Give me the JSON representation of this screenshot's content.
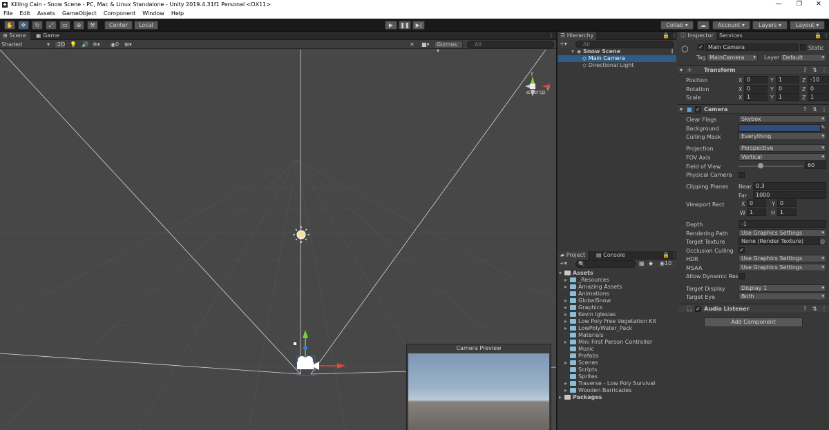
{
  "window": {
    "title": "Killing Cain - Snow Scene - PC, Mac & Linux Standalone - Unity 2019.4.31f1 Personal <DX11>",
    "minimize": "—",
    "maximize": "❐",
    "close": "✕"
  },
  "menu": [
    "File",
    "Edit",
    "Assets",
    "GameObject",
    "Component",
    "Window",
    "Help"
  ],
  "toolbar": {
    "pivot": "Center",
    "space": "Local",
    "collab": "Collab ▾",
    "account": "Account ▾",
    "layers": "Layers ▾",
    "layout": "Layout ▾"
  },
  "scene": {
    "tab_scene": "Scene",
    "tab_game": "Game",
    "draw_mode": "Shaded",
    "mode_2d": "2D",
    "hidden_count": "0",
    "gizmos": "Gizmos",
    "search_placeholder": "All",
    "persp": "Persp",
    "axis_y": "y",
    "axis_x": "x"
  },
  "preview": {
    "title": "Camera Preview"
  },
  "hierarchy": {
    "title": "Hierarchy",
    "search_placeholder": "All",
    "scene": "Snow Scene",
    "items": [
      "Main Camera",
      "Directional Light"
    ]
  },
  "project": {
    "tab_project": "Project",
    "tab_console": "Console",
    "count": "10",
    "root": "Assets",
    "folders": [
      "_Resources",
      "Amazing Assets",
      "Animations",
      "GlobalSnow",
      "Graphics",
      "Kevin Iglesias",
      "Low Poly Free Vegetation Kit",
      "LowPolyWater_Pack",
      "Materials",
      "Mini First Person Controller",
      "Music",
      "Prefabs",
      "Scenes",
      "Scripts",
      "Sprites",
      "Traverse - Low Poly Survival",
      "Wooden Barricades"
    ],
    "packages": "Packages"
  },
  "inspector": {
    "tab_inspector": "Inspector",
    "tab_services": "Services",
    "object_name": "Main Camera",
    "static": "Static",
    "tag_label": "Tag",
    "tag": "MainCamera",
    "layer_label": "Layer",
    "layer": "Default",
    "transform": {
      "title": "Transform",
      "position": "Position",
      "rotation": "Rotation",
      "scale": "Scale",
      "pos": [
        "0",
        "1",
        "-10"
      ],
      "rot": [
        "0",
        "0",
        "0"
      ],
      "scl": [
        "1",
        "1",
        "1"
      ]
    },
    "camera": {
      "title": "Camera",
      "clear_flags": "Clear Flags",
      "clear_flags_val": "Skybox",
      "background": "Background",
      "culling_mask": "Culling Mask",
      "culling_mask_val": "Everything",
      "projection": "Projection",
      "projection_val": "Perspective",
      "fov_axis": "FOV Axis",
      "fov_axis_val": "Vertical",
      "fov": "Field of View",
      "fov_val": "60",
      "physical": "Physical Camera",
      "clipping": "Clipping Planes",
      "near": "Near",
      "near_val": "0.3",
      "far": "Far",
      "far_val": "1000",
      "viewport": "Viewport Rect",
      "vx": "0",
      "vy": "0",
      "vw": "1",
      "vh": "1",
      "depth": "Depth",
      "depth_val": "-1",
      "rendering_path": "Rendering Path",
      "rendering_path_val": "Use Graphics Settings",
      "target_texture": "Target Texture",
      "target_texture_val": "None (Render Texture)",
      "occlusion": "Occlusion Culling",
      "hdr": "HDR",
      "hdr_val": "Use Graphics Settings",
      "msaa": "MSAA",
      "msaa_val": "Use Graphics Settings",
      "dyn_res": "Allow Dynamic Resol",
      "target_display": "Target Display",
      "target_display_val": "Display 1",
      "target_eye": "Target Eye",
      "target_eye_val": "Both"
    },
    "audio_listener": "Audio Listener",
    "add_component": "Add Component"
  },
  "colors": {
    "accent": "#2c5d87",
    "background_color": "#314d79"
  }
}
